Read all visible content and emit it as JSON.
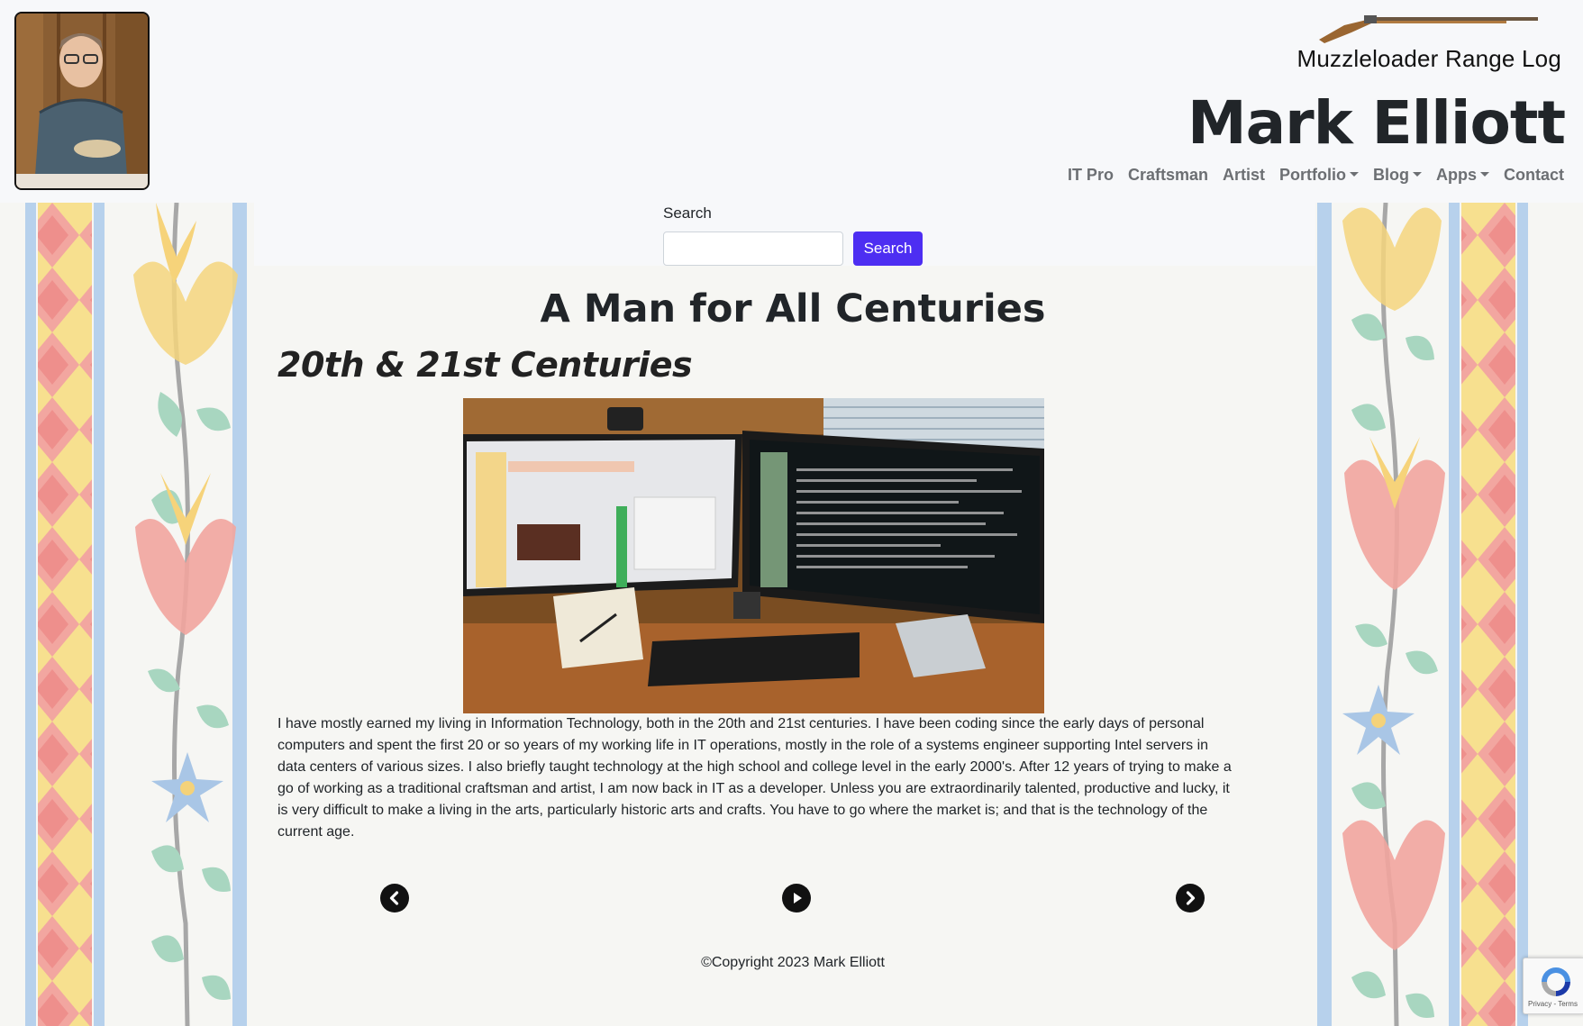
{
  "header": {
    "range_log_label": "Muzzleloader Range Log",
    "site_title": "Mark Elliott",
    "nav": [
      {
        "label": "IT Pro",
        "dropdown": false
      },
      {
        "label": "Craftsman",
        "dropdown": false
      },
      {
        "label": "Artist",
        "dropdown": false
      },
      {
        "label": "Portfolio",
        "dropdown": true
      },
      {
        "label": "Blog",
        "dropdown": true
      },
      {
        "label": "Apps",
        "dropdown": true
      },
      {
        "label": "Contact",
        "dropdown": false
      }
    ]
  },
  "search": {
    "label": "Search",
    "value": "",
    "placeholder": "",
    "button_label": "Search"
  },
  "main": {
    "page_title": "A Man for All Centuries",
    "section_title": "20th & 21st Centuries",
    "body": "I have mostly earned my living in Information Technology, both in the 20th and 21st centuries. I have been coding since the early days of personal computers and spent the first 20 or so years of my working life in IT operations, mostly in the role of a systems engineer supporting Intel servers in data centers of various sizes. I also briefly taught technology at the high school and college level in the early 2000's. After 12 years of trying to make a go of working as a traditional craftsman and artist, I am now back in IT as a developer. Unless you are extraordinarily talented, productive and lucky, it is very difficult to make a living in the arts, particularly historic arts and crafts. You have to go where the market is; and that is the technology of the current age."
  },
  "controls": {
    "previous_icon": "chevron-left-icon",
    "play_icon": "play-icon",
    "next_icon": "chevron-right-icon"
  },
  "footer": {
    "copyright": "©Copyright 2023 Mark Elliott"
  },
  "recaptcha": {
    "links": "Privacy - Terms"
  },
  "colors": {
    "accent": "#4d2ef2",
    "nav_text": "#6c6f73",
    "border_red": "#f0a2a2",
    "border_yellow": "#f6dc86",
    "border_blue": "#a9c9e8",
    "border_green": "#a8d6c0"
  }
}
